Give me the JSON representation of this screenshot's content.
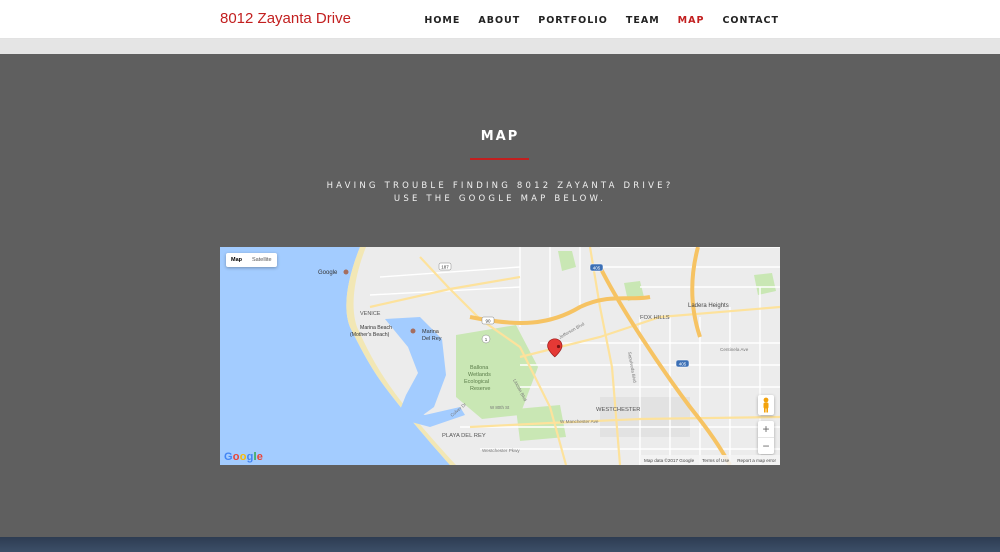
{
  "nav": {
    "brand": "8012 Zayanta Drive",
    "items": [
      "HOME",
      "ABOUT",
      "PORTFOLIO",
      "TEAM",
      "MAP",
      "CONTACT"
    ],
    "active": "MAP"
  },
  "section": {
    "title": "MAP",
    "subtitle": "HAVING TROUBLE FINDING 8012 ZAYANTA DRIVE? USE THE GOOGLE MAP BELOW."
  },
  "map": {
    "type_buttons": [
      "Map",
      "Satellite"
    ],
    "selected_type": "Map",
    "zoom_in": "+",
    "zoom_out": "−",
    "google_logo": "Google",
    "footer": [
      "Map data ©2017 Google",
      "Terms of Use",
      "Report a map error"
    ],
    "labels": {
      "google_poi": "Google",
      "venice": "VENICE",
      "marina_beach": "Marina Beach",
      "mothers_beach": "(Mother's Beach)",
      "marina_del_rey": "Marina",
      "marina_del_rey_2": "Del Rey",
      "ballona": "Ballona",
      "wetlands": "Wetlands",
      "ecological": "Ecological",
      "reserve": "Reserve",
      "playa_del_rey": "PLAYA DEL REY",
      "westchester": "WESTCHESTER",
      "fox_hills": "FOX HILLS",
      "ladera_heights": "Ladera Heights",
      "lincoln_blvd": "Lincoln Blvd",
      "w_manchester": "W Manchester Ave",
      "jefferson": "Jefferson Blvd",
      "centinela": "Centinela Ave",
      "culver_dr": "Culver Dr",
      "w_80th": "W 80th St",
      "hwy_90": "90",
      "hwy_1": "1",
      "hwy_187": "187",
      "hwy_405": "405",
      "westchester_pkwy": "Westchester Pkwy",
      "sepulveda": "Sepulveda Blvd"
    }
  },
  "colors": {
    "accent": "#c21f1f",
    "section_bg": "#5f5f5f",
    "water": "#a3ccff",
    "park": "#c9e7b4",
    "freeway": "#f6c363"
  }
}
